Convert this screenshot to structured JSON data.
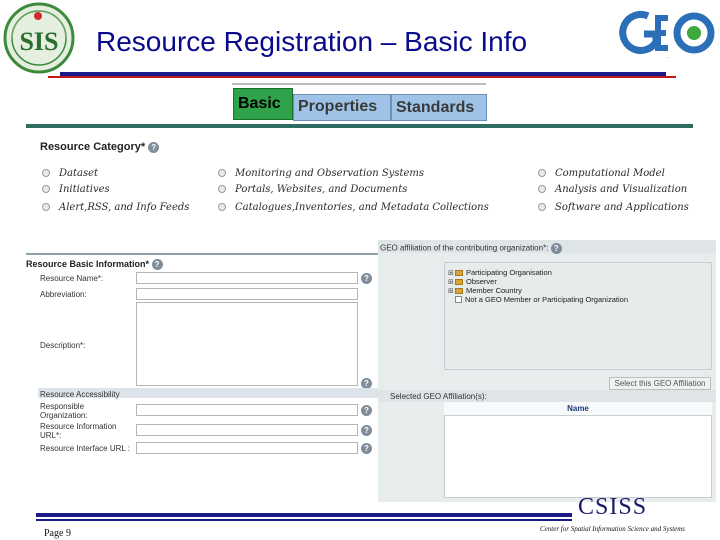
{
  "header": {
    "title": "Resource Registration – Basic Info",
    "left_logo_text": "SIS",
    "right_logo_text": "GEO"
  },
  "tabs": [
    {
      "label": "Basic",
      "active": true
    },
    {
      "label": "Properties",
      "active": false
    },
    {
      "label": "Standards",
      "active": false
    }
  ],
  "resource_category": {
    "heading": "Resource Category*",
    "options": [
      [
        "Dataset",
        "Monitoring and Observation Systems",
        "Computational Model"
      ],
      [
        "Initiatives",
        "Portals, Websites, and Documents",
        "Analysis and Visualization"
      ],
      [
        "Alert,RSS, and Info Feeds",
        "Catalogues,Inventories, and Metadata Collections",
        "Software and Applications"
      ]
    ]
  },
  "basic_info": {
    "heading": "Resource Basic Information*",
    "fields": {
      "resource_name": "Resource Name*:",
      "abbreviation": "Abbreviation:",
      "description": "Description*:",
      "accessibility": "Resource Accessibility",
      "responsible_org": "Responsible Organization:",
      "info_url": "Resource Information URL*:",
      "interface_url": "Resource Interface URL :"
    }
  },
  "affiliation": {
    "heading": "GEO affiliation of the contributing organization*:",
    "tree": [
      {
        "label": "Participating Organisation",
        "kind": "folder"
      },
      {
        "label": "Observer",
        "kind": "folder"
      },
      {
        "label": "Member Country",
        "kind": "folder"
      },
      {
        "label": "Not a GEO Member or Participating Organization",
        "kind": "checkbox"
      }
    ],
    "select_button": "Select this GEO Affiliation",
    "selected_heading": "Selected GEO Affiliation(s):",
    "name_column": "Name"
  },
  "footer": {
    "page": "Page 9",
    "org_abbr": "CSISS",
    "org_full": "Center for Spatial Information Science and Systems"
  },
  "colors": {
    "title_blue": "#0a0a8c",
    "tab_active_green": "#2fa34a",
    "tab_inactive_blue": "#9ec3e6",
    "accent_red": "#c0181a"
  }
}
